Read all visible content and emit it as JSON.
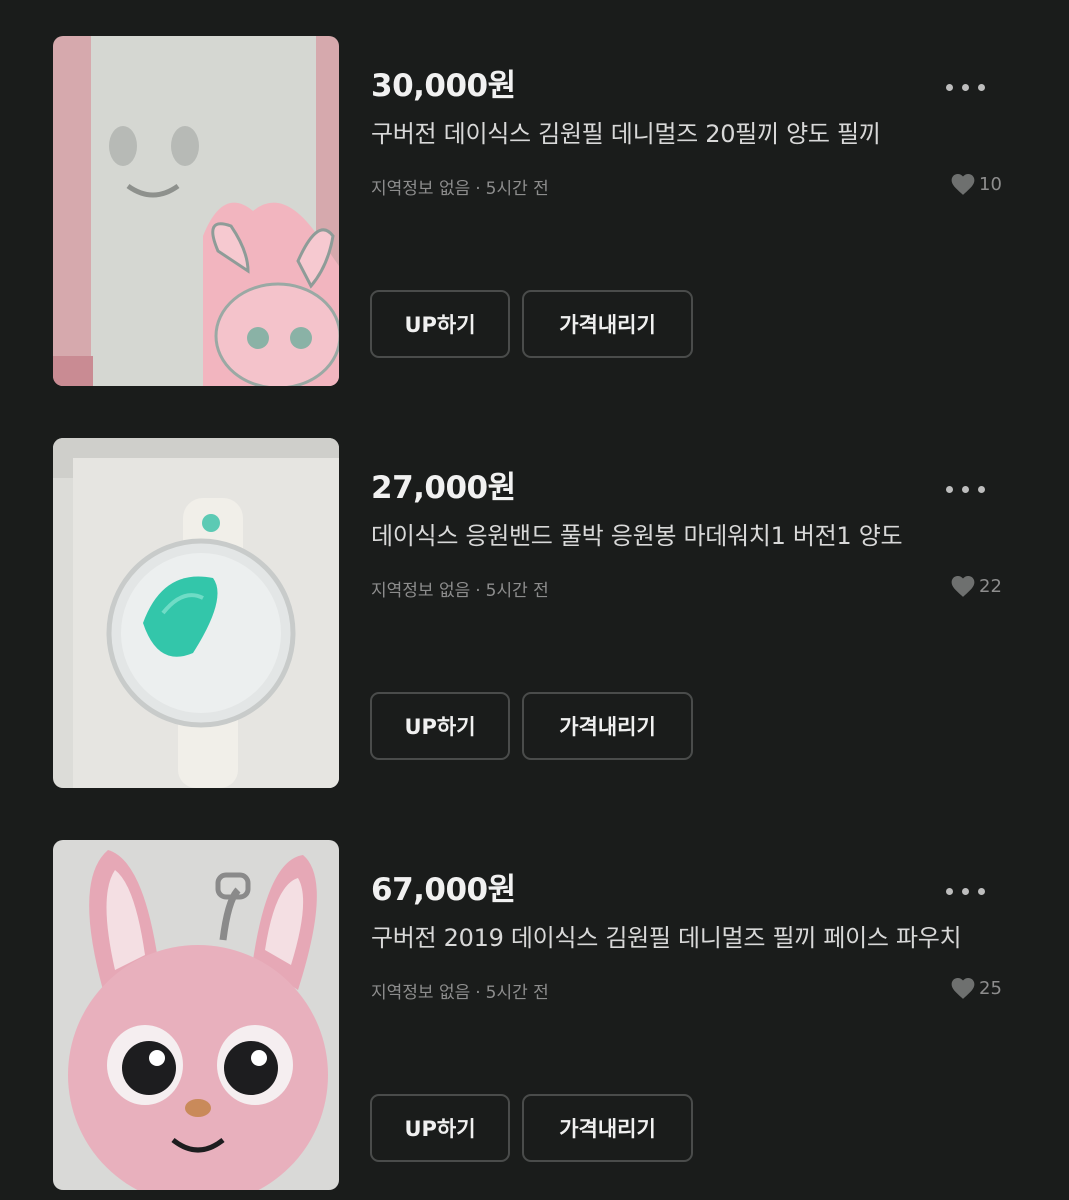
{
  "listings": [
    {
      "price": "30,000원",
      "title": "구버전 데이식스 김원필 데니멀즈 20필끼 양도 필끼",
      "location": "지역정보 없음",
      "separator": "·",
      "time": "5시간 전",
      "likes": "10",
      "up_label": "UP하기",
      "price_down_label": "가격내리기",
      "thumb_icon": "bunny-poster-photo"
    },
    {
      "price": "27,000원",
      "title": "데이식스 응원밴드 풀박 응원봉 마데워치1 버전1 양도",
      "location": "지역정보 없음",
      "separator": "·",
      "time": "5시간 전",
      "likes": "22",
      "up_label": "UP하기",
      "price_down_label": "가격내리기",
      "thumb_icon": "light-band-photo"
    },
    {
      "price": "67,000원",
      "title": "구버전 2019 데이식스 김원필 데니멀즈 필끼 페이스 파우치",
      "location": "지역정보 없음",
      "separator": "·",
      "time": "5시간 전",
      "likes": "25",
      "up_label": "UP하기",
      "price_down_label": "가격내리기",
      "thumb_icon": "bunny-plush-photo"
    }
  ],
  "colors": {
    "background": "#1a1c1b",
    "button_border": "#4a4c4b",
    "meta_text": "#8d8d8d"
  }
}
